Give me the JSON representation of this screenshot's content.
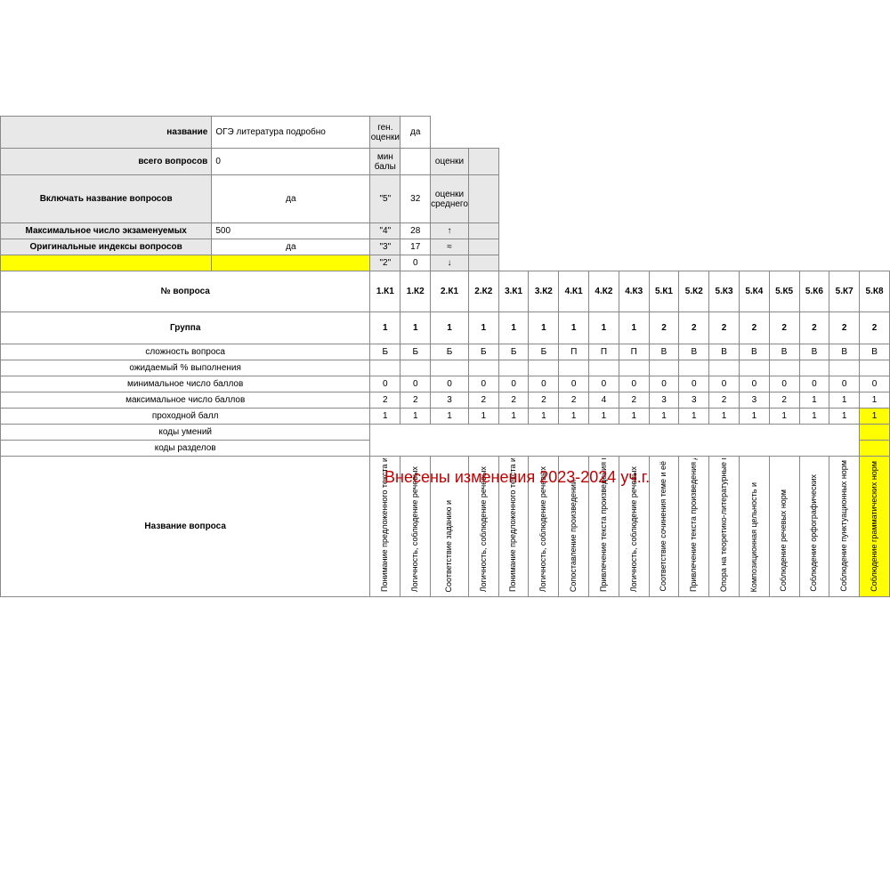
{
  "top": {
    "nameLabel": "название",
    "nameValue": "ОГЭ литература подробно",
    "genGradesLabel": "ген. оценки",
    "genGradesValue": "да",
    "totalQLabel": "всего вопросов",
    "totalQValue": "0",
    "minScoresLabel": "мин балы",
    "gradesLabel": "оценки",
    "includeQNameLabel": "Включать название вопросов",
    "includeQNameValue": "да",
    "g5": "\"5\"",
    "g5v": "32",
    "avgGradesLabel": "оценки среднего",
    "maxExamineesLabel": "Максимальное число экзаменуемых",
    "maxExamineesValue": "500",
    "g4": "\"4\"",
    "g4v": "28",
    "arrowUp": "↑",
    "origIdxLabel": "Оригинальные индексы вопросов",
    "origIdxValue": "да",
    "g3": "\"3\"",
    "g3v": "17",
    "approx": "≈",
    "g2": "\"2\"",
    "g2v": "0",
    "arrowDown": "↓"
  },
  "headers": {
    "qnum": "№ вопроса",
    "group": "Группа",
    "difficulty": "сложность вопроса",
    "expected": "ожидаемый % выполнения",
    "minpts": "минимальное число баллов",
    "maxpts": "максимальное число баллов",
    "passpts": "проходной балл",
    "skillcodes": "коды умений",
    "sectioncodes": "коды разделов",
    "qname": "Название вопроса"
  },
  "cols": [
    "1.К1",
    "1.К2",
    "2.К1",
    "2.К2",
    "3.К1",
    "3.К2",
    "4.К1",
    "4.К2",
    "4.К3",
    "5.К1",
    "5.К2",
    "5.К3",
    "5.К4",
    "5.К5",
    "5.К6",
    "5.К7",
    "5.К8"
  ],
  "group": [
    "1",
    "1",
    "1",
    "1",
    "1",
    "1",
    "1",
    "1",
    "1",
    "2",
    "2",
    "2",
    "2",
    "2",
    "2",
    "2",
    "2"
  ],
  "difficulty": [
    "Б",
    "Б",
    "Б",
    "Б",
    "Б",
    "Б",
    "П",
    "П",
    "П",
    "В",
    "В",
    "В",
    "В",
    "В",
    "В",
    "В",
    "В"
  ],
  "minpts": [
    "0",
    "0",
    "0",
    "0",
    "0",
    "0",
    "0",
    "0",
    "0",
    "0",
    "0",
    "0",
    "0",
    "0",
    "0",
    "0",
    "0"
  ],
  "maxpts": [
    "2",
    "2",
    "3",
    "2",
    "2",
    "2",
    "2",
    "4",
    "2",
    "3",
    "3",
    "2",
    "3",
    "2",
    "1",
    "1",
    "1"
  ],
  "passpts": [
    "1",
    "1",
    "1",
    "1",
    "1",
    "1",
    "1",
    "1",
    "1",
    "1",
    "1",
    "1",
    "1",
    "1",
    "1",
    "1",
    "1"
  ],
  "vheads": [
    "Понимание предложенного текста и привлечение",
    "Логичность, соблюдение речевых",
    "Соответствие заданию и",
    "Логичность, соблюдение речевых",
    "Понимание предложенного текста и привлечение",
    "Логичность, соблюдение речевых",
    "Сопоставление произведений",
    "Привлечение текста произведения при сопоставлении",
    "Логичность, соблюдение речевых",
    "Соответствие сочинения теме и её",
    "Привлечение текста произведения для",
    "Опора на теоретико-литературные понятия",
    "Композиционная цельность и",
    "Соблюдение речевых норм",
    "Соблюдение орфографических",
    "Соблюдение пунктуационных норм",
    "Соблюдение грамматических норм"
  ],
  "overlay": "Внесены изменения 2023-2024 уч.г."
}
